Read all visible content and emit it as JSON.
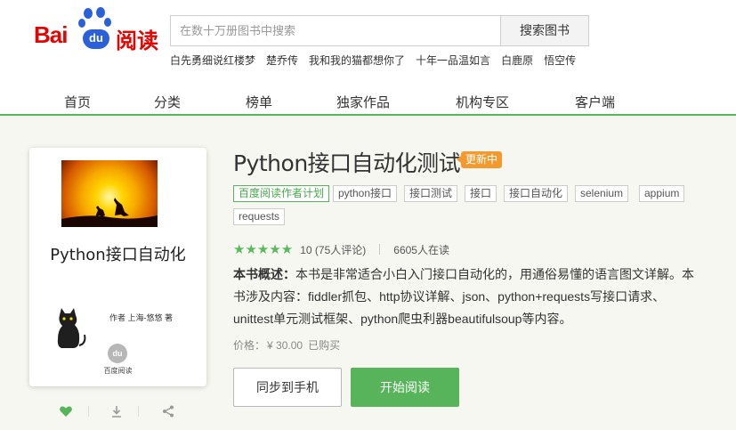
{
  "logo": {
    "bai": "Bai",
    "du": "du",
    "reading": "阅读"
  },
  "search": {
    "placeholder": "在数十万册图书中搜索",
    "button": "搜索图书"
  },
  "hot_words": [
    "白先勇细说红楼梦",
    "楚乔传",
    "我和我的猫都想你了",
    "十年一品温如言",
    "白鹿原",
    "悟空传"
  ],
  "nav": [
    "首页",
    "分类",
    "榜单",
    "独家作品",
    "机构专区",
    "客户端"
  ],
  "cover": {
    "title": "Python接口自动化",
    "author": "作者 上海-悠悠 著",
    "logo_mark": "du",
    "logo_text": "百度阅读"
  },
  "book": {
    "title": "Python接口自动化测试",
    "badge": "更新中",
    "tags": [
      "百度阅读作者计划",
      "python接口",
      "接口测试",
      "接口",
      "接口自动化",
      "selenium",
      "appium",
      "requests"
    ],
    "stars": "★★★★★",
    "rating": "10 (75人评论)",
    "readers": "6605人在读",
    "summary_label": "本书概述：",
    "summary_text": "本书是非常适合小白入门接口自动化的，用通俗易懂的语言图文详解。本书涉及内容：fiddler抓包、http协议详解、json、python+requests写接口请求、unittest单元测试框架、python爬虫利器beautifulsoup等内容。",
    "price_label": "价格：",
    "price_value": "¥ 30.00",
    "bought": "已购买"
  },
  "buttons": {
    "sync": "同步到手机",
    "read": "开始阅读"
  },
  "colors": {
    "brand_red": "#e10601",
    "brand_blue": "#2a61d8",
    "accent_green": "#57b45b",
    "badge_orange": "#f29a2e"
  },
  "icons": {
    "favorite": "heart-icon",
    "download": "download-icon",
    "share": "share-icon"
  }
}
